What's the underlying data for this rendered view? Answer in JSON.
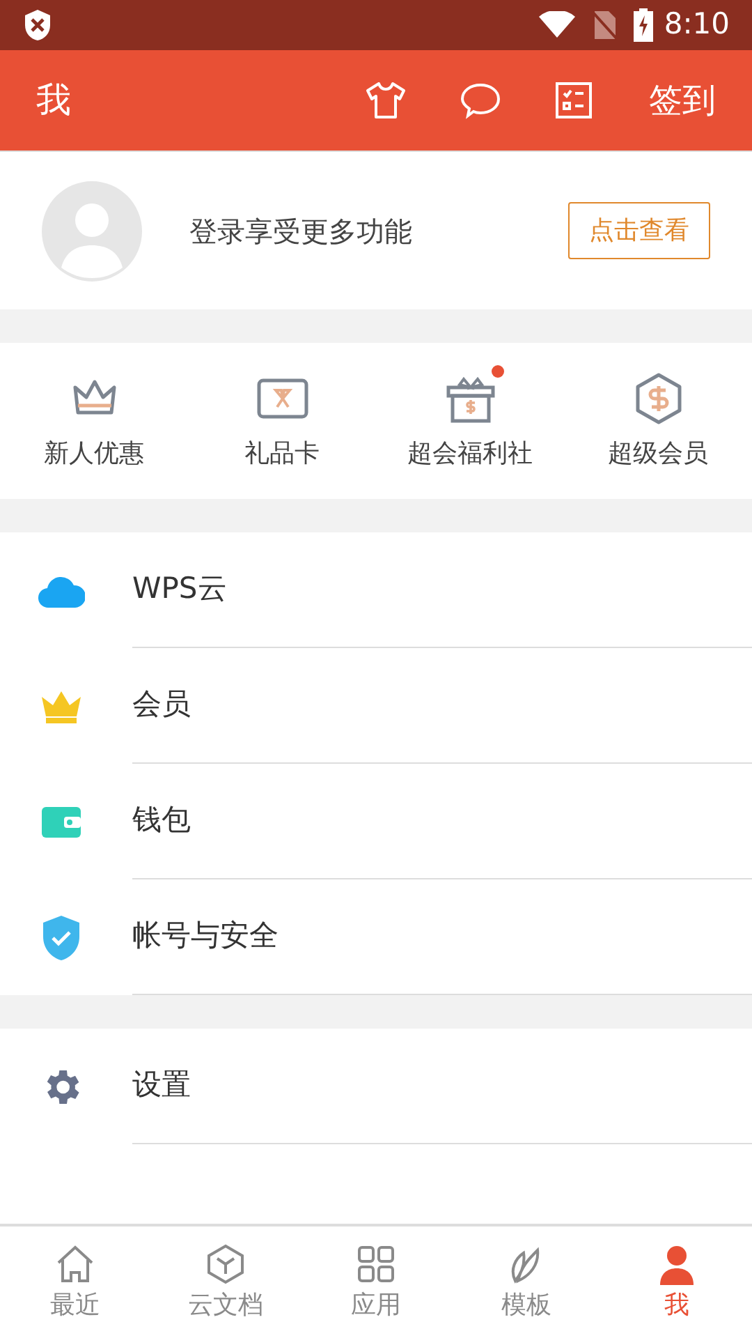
{
  "status_bar": {
    "time": "8:10"
  },
  "header": {
    "title": "我",
    "checkin": "签到"
  },
  "profile": {
    "prompt": "登录享受更多功能",
    "button": "点击查看"
  },
  "quick_links": [
    {
      "kind": "crown",
      "label": "新人优惠",
      "badge": false
    },
    {
      "kind": "giftcard",
      "label": "礼品卡",
      "badge": false
    },
    {
      "kind": "gift",
      "label": "超会福利社",
      "badge": true
    },
    {
      "kind": "hexagon",
      "label": "超级会员",
      "badge": false
    }
  ],
  "menu_groups": [
    [
      {
        "kind": "cloud",
        "label": "WPS云"
      },
      {
        "kind": "crown",
        "label": "会员"
      },
      {
        "kind": "wallet",
        "label": "钱包"
      },
      {
        "kind": "shield",
        "label": "帐号与安全"
      }
    ],
    [
      {
        "kind": "gear",
        "label": "设置"
      }
    ]
  ],
  "bottom_nav": [
    {
      "kind": "home",
      "label": "最近",
      "selected": false
    },
    {
      "kind": "cube",
      "label": "云文档",
      "selected": false
    },
    {
      "kind": "grid",
      "label": "应用",
      "selected": false
    },
    {
      "kind": "leaf",
      "label": "模板",
      "selected": false
    },
    {
      "kind": "person",
      "label": "我",
      "selected": true
    }
  ]
}
